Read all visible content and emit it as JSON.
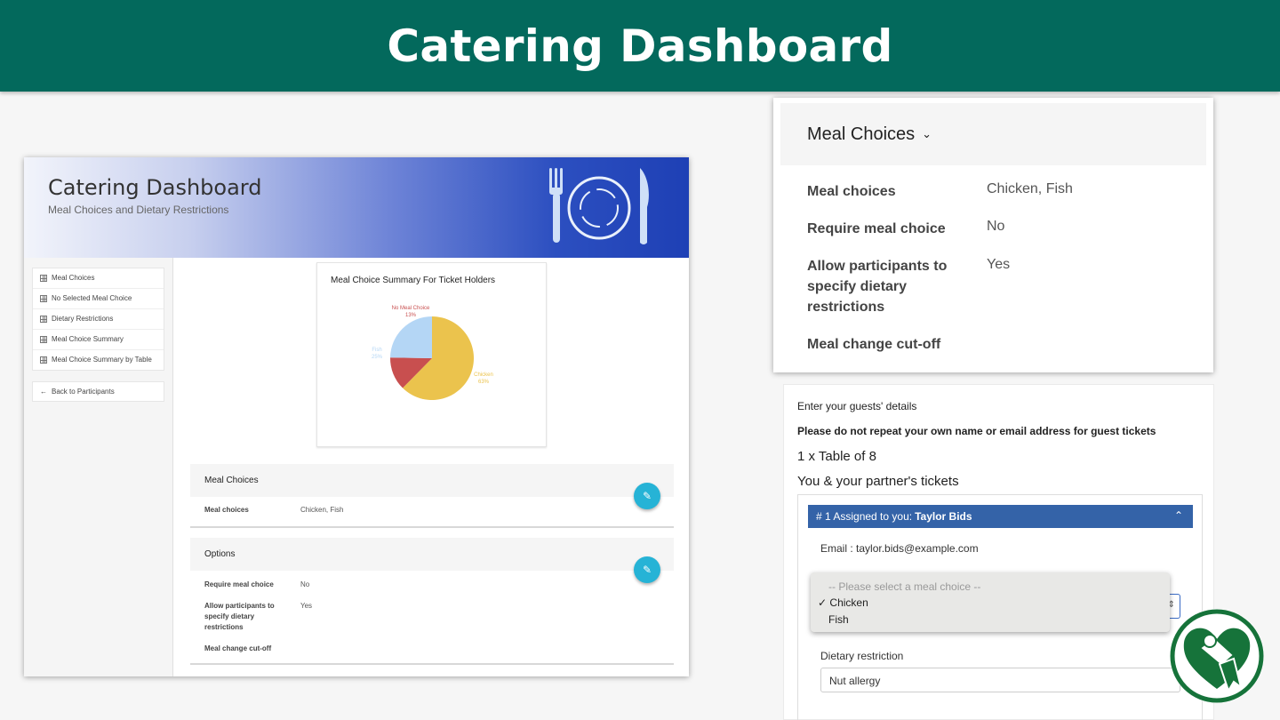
{
  "banner": {
    "title": "Catering Dashboard"
  },
  "dashboard": {
    "title": "Catering Dashboard",
    "subtitle": "Meal Choices and Dietary Restrictions",
    "sidebar": {
      "items": [
        {
          "label": "Meal Choices",
          "icon": "grid-icon"
        },
        {
          "label": "No Selected Meal Choice",
          "icon": "grid-icon"
        },
        {
          "label": "Dietary Restrictions",
          "icon": "grid-icon"
        },
        {
          "label": "Meal Choice Summary",
          "icon": "grid-icon"
        },
        {
          "label": "Meal Choice Summary by Table",
          "icon": "grid-icon"
        }
      ],
      "back": {
        "arrow": "←",
        "label": "Back to Participants"
      }
    },
    "chart_card": {
      "title": "Meal Choice Summary For Ticket Holders"
    },
    "meal_card": {
      "heading": "Meal Choices",
      "rows": [
        {
          "key": "Meal choices",
          "value": "Chicken, Fish"
        }
      ]
    },
    "options_card": {
      "heading": "Options",
      "rows": [
        {
          "key": "Require meal choice",
          "value": "No"
        },
        {
          "key": "Allow participants to specify dietary restrictions",
          "value": "Yes"
        },
        {
          "key": "Meal change cut-off",
          "value": ""
        }
      ]
    },
    "edit_icon": "✎"
  },
  "chart_data": {
    "type": "pie",
    "title": "Meal Choice Summary For Ticket Holders",
    "slices": [
      {
        "label": "Chicken",
        "percent_label": "63%",
        "value": 63,
        "color": "#ebc34d"
      },
      {
        "label": "No Meal Choice",
        "percent_label": "13%",
        "value": 13,
        "color": "#c84f4f"
      },
      {
        "label": "Fish",
        "percent_label": "25%",
        "value": 25,
        "color": "#b4d6f5"
      }
    ]
  },
  "settings_panel": {
    "heading": "Meal Choices",
    "chevron": "⌄",
    "rows": [
      {
        "key": "Meal choices",
        "value": "Chicken, Fish"
      },
      {
        "key": "Require meal choice",
        "value": "No"
      },
      {
        "key": "Allow participants to specify dietary restrictions",
        "value": "Yes"
      },
      {
        "key": "Meal change cut-off",
        "value": ""
      }
    ]
  },
  "guest_form": {
    "intro": "Enter your guests' details",
    "warning": "Please do not repeat your own name or email address for guest tickets",
    "ticket_type": "1 x Table of 8",
    "section_title": "You & your partner's tickets",
    "assignment": {
      "prefix": "# 1 Assigned to you:",
      "name": "Taylor Bids",
      "chevron": "⌃"
    },
    "email_label": "Email :",
    "email_value": "taylor.bids@example.com",
    "meal_dropdown": {
      "placeholder": "-- Please select a meal choice --",
      "options": [
        "Chicken",
        "Fish"
      ],
      "selected": "Chicken",
      "check": "✓"
    },
    "dietary_label": "Dietary restriction",
    "dietary_value": "Nut allergy"
  },
  "colors": {
    "banner": "#03695c",
    "accent_blue": "#3463a8",
    "fab": "#26b3d6",
    "logo_green": "#16733a"
  }
}
